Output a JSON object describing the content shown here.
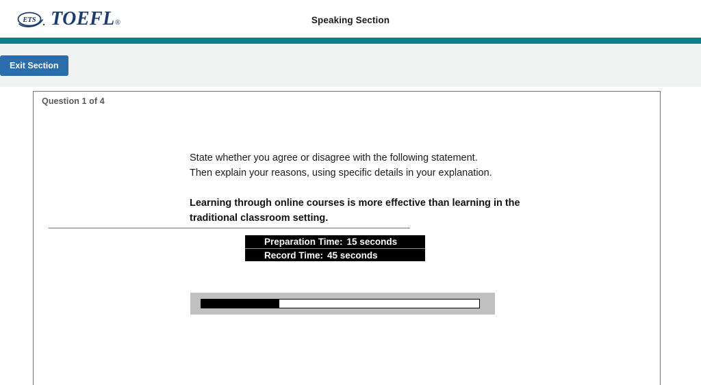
{
  "header": {
    "logo_icon": "ets-oval-logo-icon",
    "brand_text": "TOEFL",
    "brand_registered": "®",
    "title": "Speaking Section",
    "accent_color": "#0e7f88",
    "brand_color": "#1b3a73"
  },
  "subheader": {
    "exit_label": "Exit Section",
    "exit_color": "#2b6cab",
    "background": "#f0f2f2"
  },
  "panel": {
    "question_label": "Question 1 of 4"
  },
  "prompt": {
    "line1": "State whether you agree or disagree with the following statement.",
    "line2": "Then explain your reasons, using specific details in your explanation.",
    "statement": "Learning through online courses is more effective than learning in the traditional classroom setting."
  },
  "timing": {
    "prep_label": "Preparation Time:",
    "prep_value": "15 seconds",
    "record_label": "Record Time:",
    "record_value": "45 seconds"
  },
  "progress": {
    "percent": 28,
    "fill_width": "28%",
    "fill_color": "#000000",
    "track_color": "#ffffff",
    "frame_color": "#c0c0c0"
  }
}
